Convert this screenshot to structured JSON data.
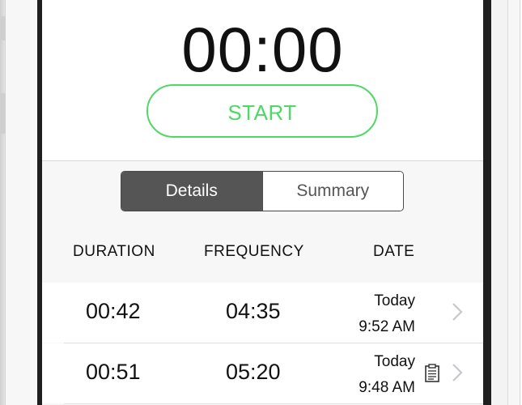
{
  "timer": {
    "display": "00:00",
    "start_label": "START"
  },
  "segmented_control": {
    "options": [
      {
        "label": "Details",
        "selected": true
      },
      {
        "label": "Summary",
        "selected": false
      }
    ]
  },
  "table": {
    "headers": {
      "duration": "DURATION",
      "frequency": "FREQUENCY",
      "date": "DATE"
    },
    "rows": [
      {
        "duration": "00:42",
        "frequency": "04:35",
        "day": "Today",
        "time": "9:52 AM",
        "has_note": false
      },
      {
        "duration": "00:51",
        "frequency": "05:20",
        "day": "Today",
        "time": "9:48 AM",
        "has_note": true
      }
    ]
  },
  "colors": {
    "accent": "#4cd964",
    "segment_active": "#555555",
    "bezel": "#1f1f1f"
  },
  "icons": {
    "row_chevron": "chevron-right-icon",
    "note": "note-icon"
  }
}
